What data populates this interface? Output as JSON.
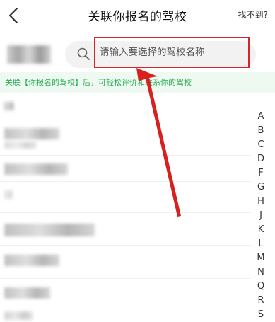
{
  "header": {
    "title": "关联你报名的驾校",
    "action_label": "找不到?"
  },
  "search": {
    "placeholder": "请输入要选择的驾校名称"
  },
  "banner": {
    "text": "关联【你报名的驾校】后，可轻松评价和联系你的驾校"
  },
  "index_letters": [
    "A",
    "B",
    "C",
    "D",
    "F",
    "G",
    "H",
    "J",
    "K",
    "L",
    "M",
    "N",
    "Q",
    "R",
    "S"
  ],
  "colors": {
    "highlight": "#d32626",
    "banner_text": "#2fae57",
    "banner_bg": "#eefaf1"
  },
  "icons": [
    "back-arrow-icon",
    "search-icon"
  ]
}
